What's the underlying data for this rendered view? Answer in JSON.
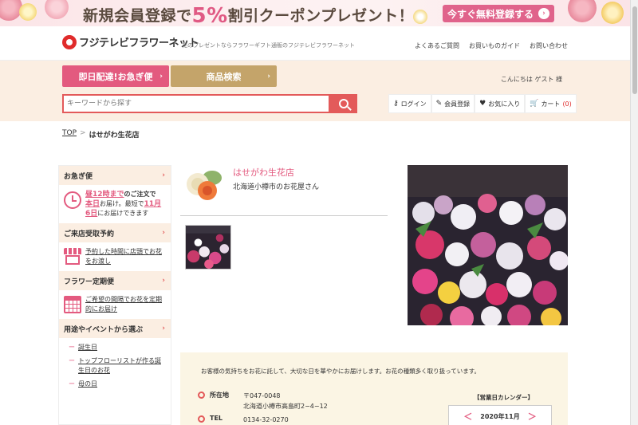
{
  "banner": {
    "text_before": "新規会員登録で",
    "percent": "5%",
    "text_after": "割引クーポンプレゼント！",
    "cta_label": "今すぐ無料登録する",
    "cta_arrow": "›"
  },
  "header": {
    "logo_text": "フジテレビフラワーネット",
    "tagline": "花のプレゼントならフラワーギフト通販のフジテレビフラワーネット",
    "links": [
      "よくあるご質問",
      "お買いものガイド",
      "お問い合わせ"
    ]
  },
  "nav": {
    "express_label": "即日配達!お急ぎ便",
    "products_label": "商品検索",
    "chevron": "›",
    "greeting": "こんにちは ゲスト 様"
  },
  "search": {
    "placeholder": "キーワードから探す"
  },
  "account": {
    "login": "ログイン",
    "register": "会員登録",
    "favorites": "お気に入り",
    "cart": "カート",
    "cart_count_text": "(0)"
  },
  "breadcrumb": {
    "top": "TOP",
    "sep": ">",
    "current": "はせがわ生花店"
  },
  "sidebar": {
    "express": {
      "title": "お急ぎ便",
      "line1_hl": "昼12時まで",
      "line1_rest": "のご注文で",
      "line2_hl": "本日",
      "line2_rest": "お届け。最短で",
      "line2_hl2": "11月",
      "line3_hl": "6日",
      "line3_rest": "にお届けできます"
    },
    "pickup": {
      "title": "ご来店受取予約",
      "text": "予約した時間に店頭でお花をお渡し"
    },
    "subscription": {
      "title": "フラワー定期便",
      "text": "ご希望の間隔でお花を定期的にお届け"
    },
    "occasions": {
      "title": "用途やイベントから選ぶ",
      "items": [
        "誕生日",
        "トップフローリストが作る誕生日のお花",
        "母の日"
      ]
    },
    "chevron": "›",
    "dash": "ー"
  },
  "shop": {
    "name": "はせがわ生花店",
    "subtitle": "北海道小樽市のお花屋さん"
  },
  "info": {
    "description": "お客様の気持ちをお花に託して、大切な日を華やかにお届けします。お花の種類多く取り扱っています。",
    "address_label": "所在地",
    "postal": "〒047-0048",
    "address": "北海道小樽市高島町2−4−12",
    "tel_label": "TEL",
    "tel": "0134-32-0270",
    "calendar_title": "【営業日カレンダー】",
    "calendar_month": "2020年11月",
    "prev": "＜",
    "next": "＞"
  },
  "colors": {
    "accent_pink": "#e35a7f",
    "accent_gold": "#c4a46a",
    "search_red": "#e35a5a",
    "band_beige": "#fbeee2"
  }
}
